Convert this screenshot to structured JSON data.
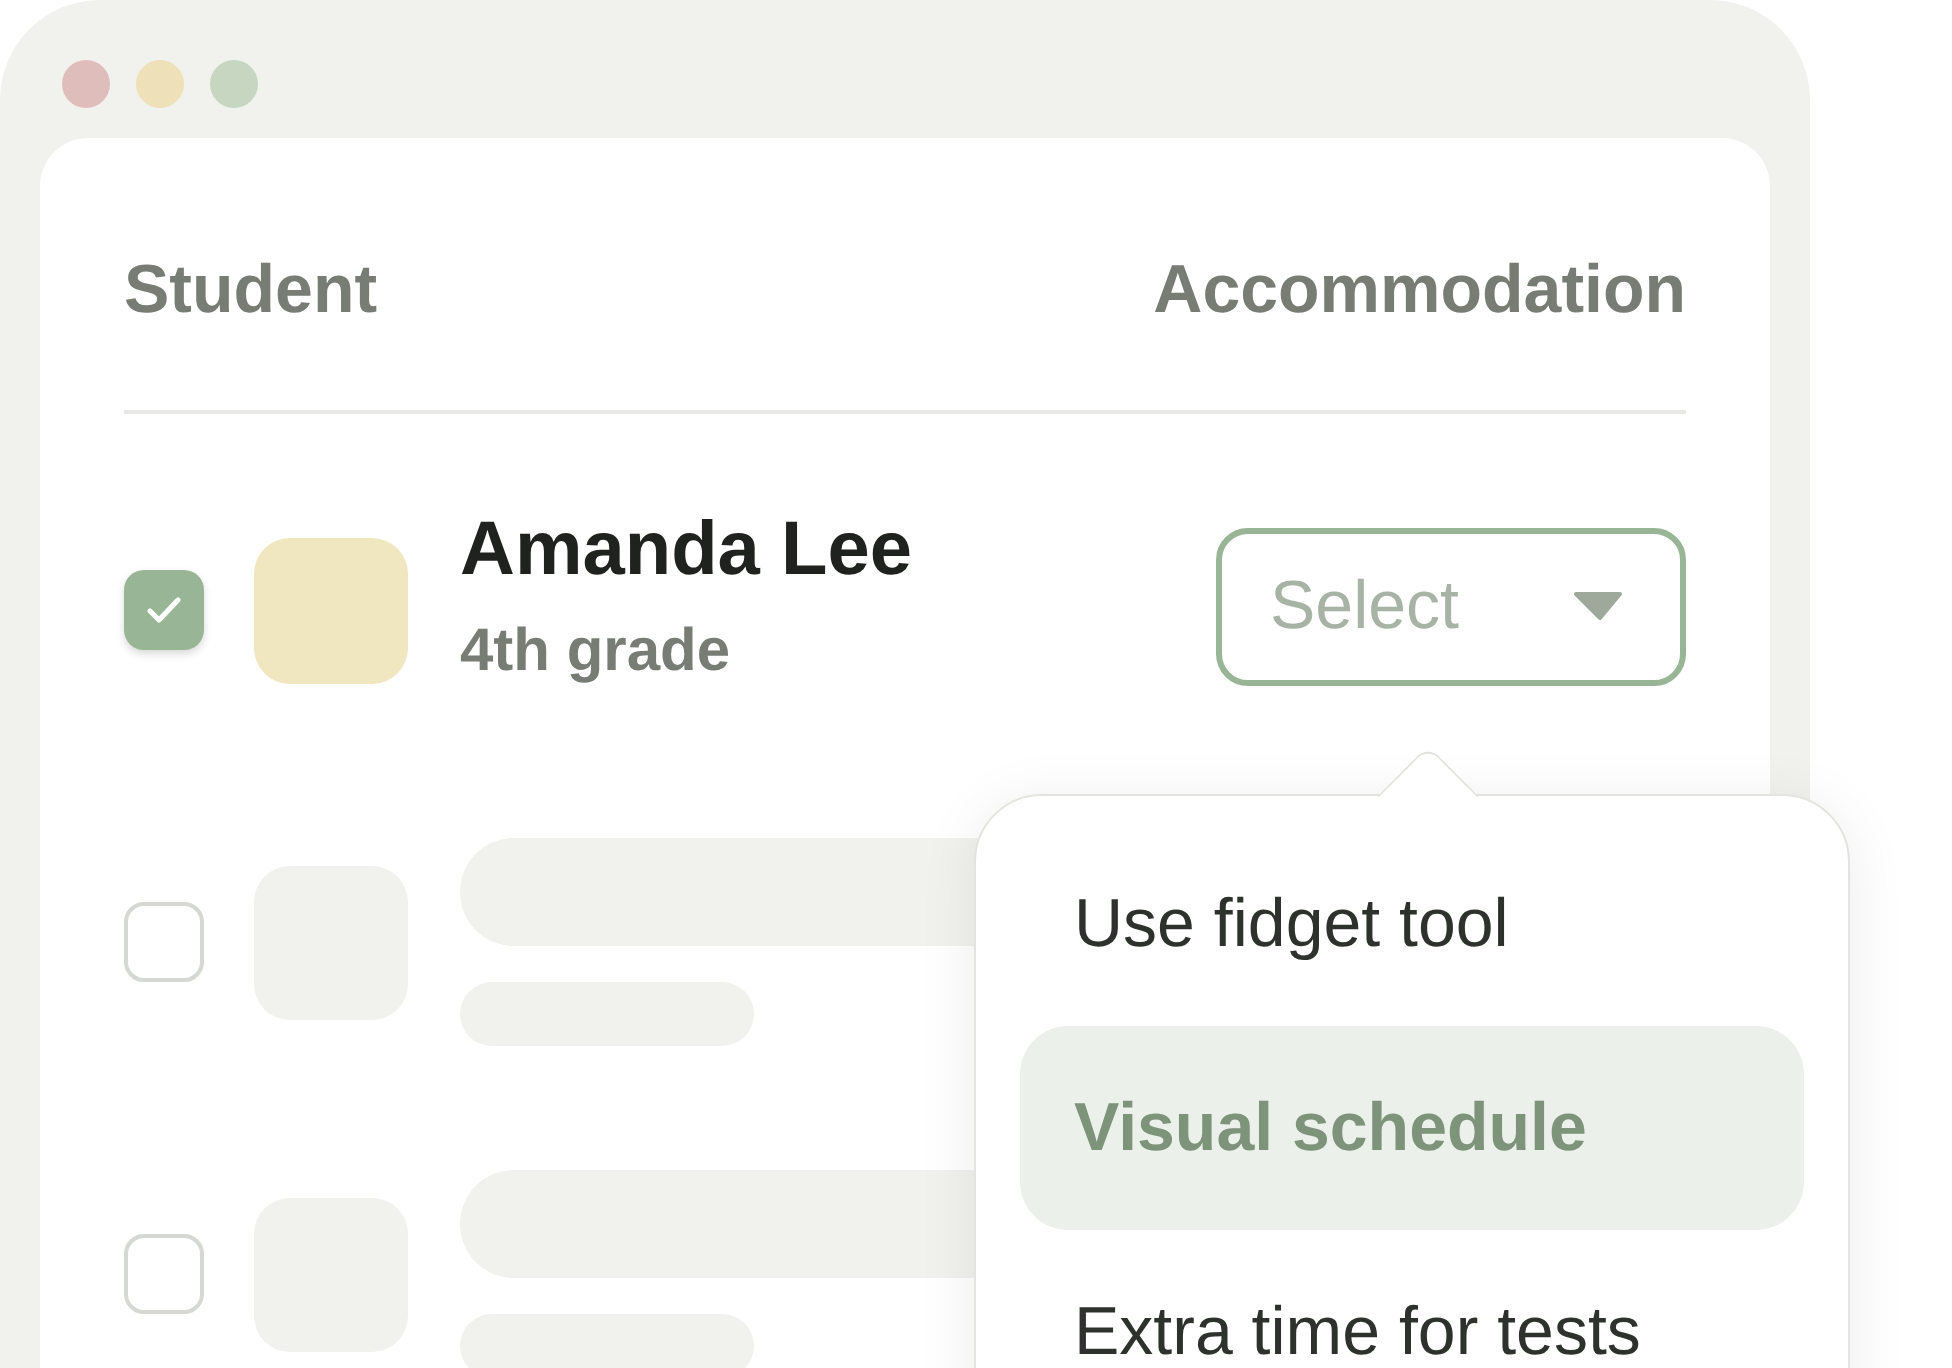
{
  "table": {
    "columns": [
      "Student",
      "Accommodation"
    ],
    "rows": [
      {
        "kind": "student",
        "checked": true,
        "name": "Amanda Lee",
        "grade": "4th grade",
        "select": {
          "placeholder": "Select",
          "expanded": true
        }
      },
      {
        "kind": "placeholder",
        "checked": false
      },
      {
        "kind": "placeholder",
        "checked": false
      }
    ]
  },
  "dropdown": {
    "items": [
      {
        "label": "Use fidget tool",
        "selected": false
      },
      {
        "label": "Visual schedule",
        "selected": true
      },
      {
        "label": "Extra time for tests",
        "selected": false
      }
    ]
  }
}
